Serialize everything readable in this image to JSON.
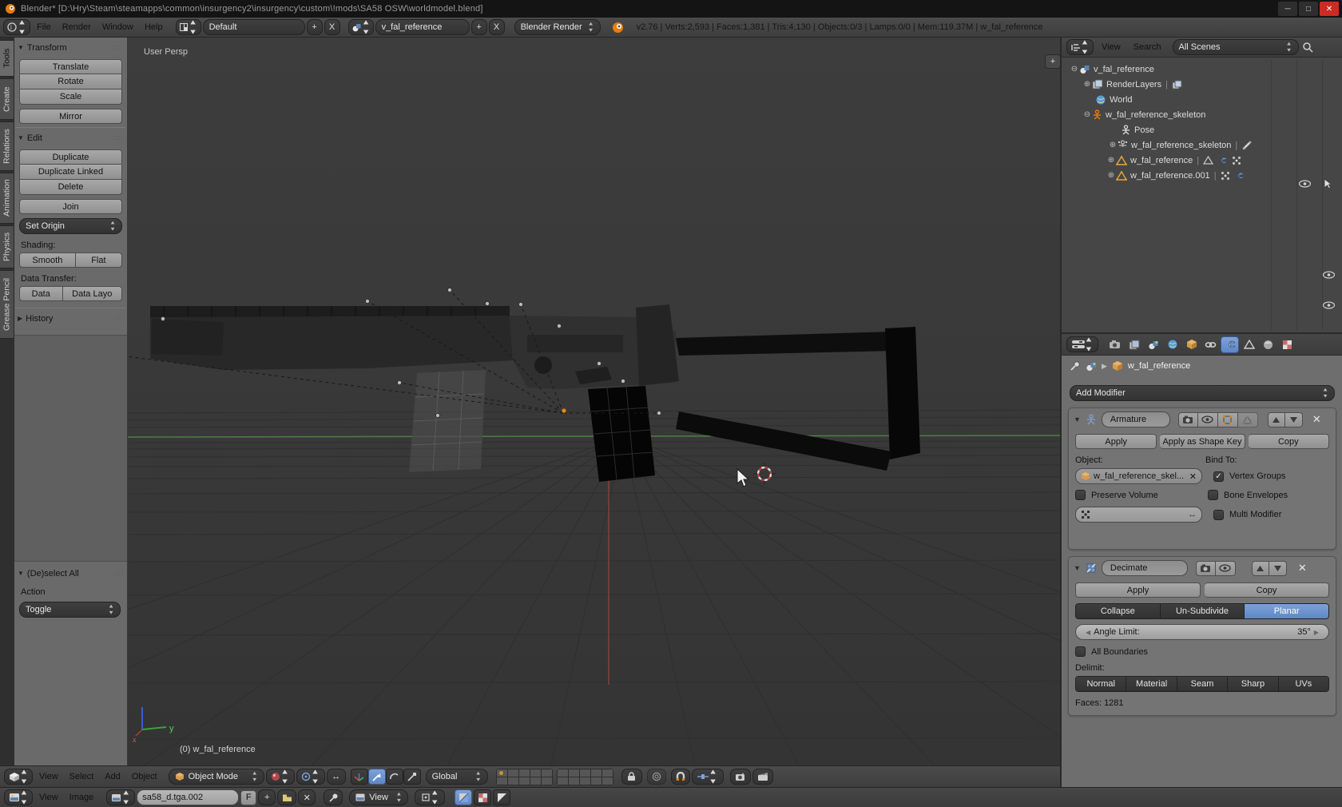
{
  "colors": {
    "accent_blue": "#6f96d2",
    "blender_orange": "#e87d0d",
    "close_red": "#cc2b23"
  },
  "titlebar": {
    "title": "Blender* [D:\\Hry\\Steam\\steamapps\\common\\insurgency2\\insurgency\\custom\\!mods\\SA58 OSW\\worldmodel.blend]"
  },
  "menubar": {
    "menus": [
      "File",
      "Render",
      "Window",
      "Help"
    ],
    "layout": "Default",
    "scene": "v_fal_reference",
    "engine": "Blender Render",
    "stats": "v2.76 | Verts:2,593 | Faces:1,381 | Tris:4,130 | Objects:0/3 | Lamps:0/0 | Mem:119.37M | w_fal_reference",
    "add_label": "+",
    "close_label": "X"
  },
  "toolshelf": {
    "tabs": [
      "Tools",
      "Create",
      "Relations",
      "Animation",
      "Physics",
      "Grease Pencil"
    ],
    "transform_title": "Transform",
    "translate": "Translate",
    "rotate": "Rotate",
    "scale": "Scale",
    "mirror": "Mirror",
    "edit_title": "Edit",
    "duplicate": "Duplicate",
    "duplicate_linked": "Duplicate Linked",
    "delete": "Delete",
    "join": "Join",
    "set_origin": "Set Origin",
    "shading_label": "Shading:",
    "smooth": "Smooth",
    "flat": "Flat",
    "data_transfer_label": "Data Transfer:",
    "data": "Data",
    "data_layo": "Data Layo",
    "history_title": "History",
    "deselect_title": "(De)select All",
    "action_label": "Action",
    "toggle": "Toggle"
  },
  "viewport": {
    "label": "User Persp",
    "info": "(0) w_fal_reference",
    "axis_y": "y",
    "axis_x": "x",
    "plus": "+"
  },
  "outliner": {
    "view": "View",
    "search": "Search",
    "scenes": "All Scenes",
    "rows": [
      {
        "label": "v_fal_reference"
      },
      {
        "label": "RenderLayers"
      },
      {
        "label": "World"
      },
      {
        "label": "w_fal_reference_skeleton"
      },
      {
        "label": "Pose"
      },
      {
        "label": "w_fal_reference_skeleton"
      },
      {
        "label": "w_fal_reference"
      },
      {
        "label": "w_fal_reference.001"
      }
    ]
  },
  "properties": {
    "breadcrumb": "w_fal_reference",
    "add_modifier": "Add Modifier",
    "armature": {
      "name": "Armature",
      "apply": "Apply",
      "apply_shape": "Apply as Shape Key",
      "copy": "Copy",
      "object_label": "Object:",
      "bind_label": "Bind To:",
      "object_value": "w_fal_reference_skel...",
      "vertex_groups": "Vertex Groups",
      "bone_envelopes": "Bone Envelopes",
      "preserve_volume": "Preserve Volume",
      "multi_modifier": "Multi Modifier",
      "check": "✓"
    },
    "decimate": {
      "name": "Decimate",
      "apply": "Apply",
      "copy": "Copy",
      "collapse": "Collapse",
      "unsubdivide": "Un-Subdivide",
      "planar": "Planar",
      "angle_label": "Angle Limit:",
      "angle_value": "35°",
      "all_boundaries": "All Boundaries",
      "delimit_label": "Delimit:",
      "delimit": [
        "Normal",
        "Material",
        "Seam",
        "Sharp",
        "UVs"
      ],
      "faces": "Faces: 1281"
    }
  },
  "view3d_header": {
    "menus": [
      "View",
      "Select",
      "Add",
      "Object"
    ],
    "mode": "Object Mode",
    "orientation": "Global"
  },
  "image_header": {
    "menus": [
      "View",
      "Image"
    ],
    "image_name": "sa58_d.tga.002",
    "fake_user": "F",
    "view_mode": "View"
  }
}
